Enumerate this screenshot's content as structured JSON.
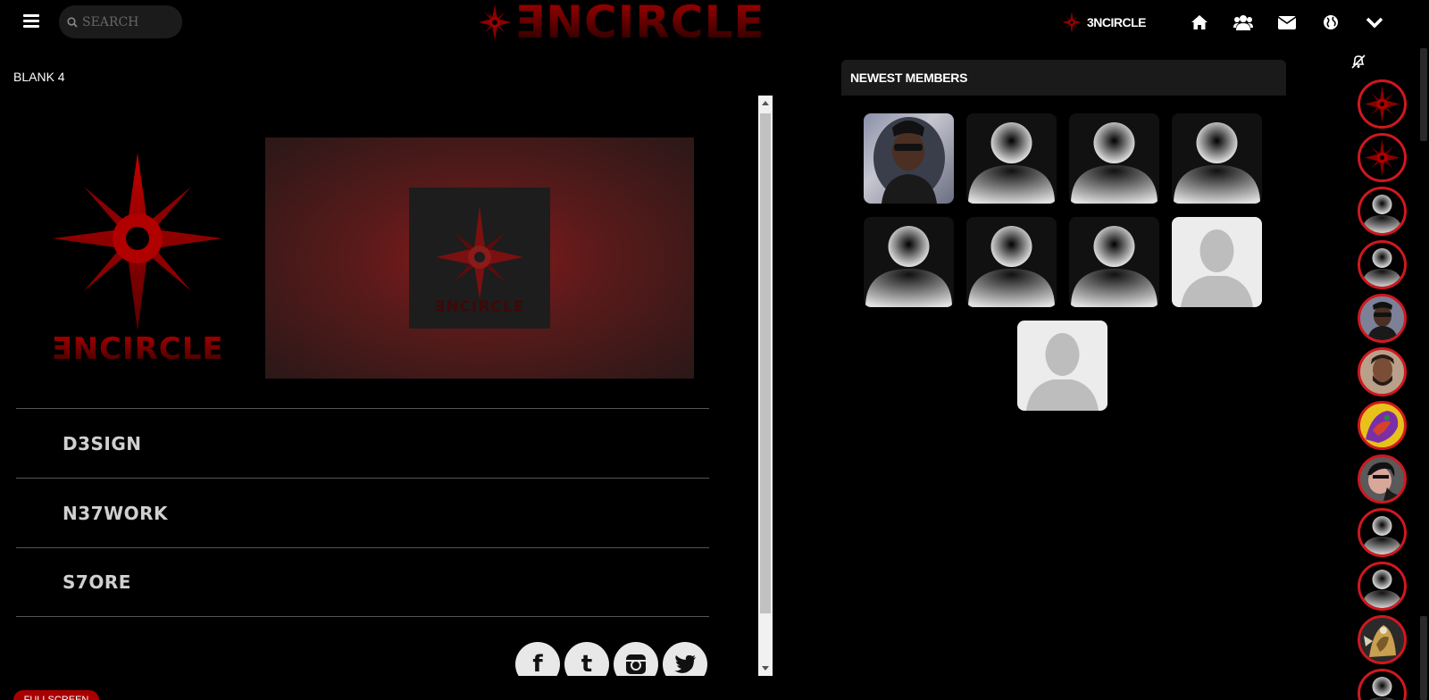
{
  "header": {
    "search_placeholder": "SEARCH",
    "brand_title": "ƎNCIRCLE",
    "site_label": "3NCIRCLE",
    "nav_icons": [
      "home-icon",
      "users-icon",
      "envelope-icon",
      "globe-icon",
      "chevron-down-icon"
    ]
  },
  "page": {
    "title": "BLANK 4",
    "logo_text": "ƎNCIRCLE",
    "banner_text": "ƎNCIRCLE",
    "menu": [
      "D3SIGN",
      "N37WORK",
      "S7ORE"
    ],
    "socials": [
      {
        "icon": "facebook-icon",
        "glyph": "f"
      },
      {
        "icon": "tumblr-icon",
        "glyph": "t"
      },
      {
        "icon": "instagram-icon",
        "glyph": ""
      },
      {
        "icon": "twitter-icon",
        "glyph": ""
      }
    ],
    "fullscreen_label": "FULLSCREEN"
  },
  "members": {
    "header": "NEWEST MEMBERS",
    "avatars": [
      "photo-sunglasses",
      "default-dark",
      "default-dark",
      "default-dark",
      "default-dark",
      "default-dark",
      "default-dark",
      "default-light",
      "default-light"
    ]
  },
  "rail": {
    "avatars": [
      "logo",
      "logo",
      "default",
      "default",
      "photo-sunglasses",
      "photo-beard",
      "photo-colorful",
      "photo-glasses",
      "default",
      "default",
      "photo-art",
      "default"
    ]
  },
  "colors": {
    "accent_red": "#d0181e",
    "brand_dark_red": "#8b0000",
    "background": "#000000"
  }
}
